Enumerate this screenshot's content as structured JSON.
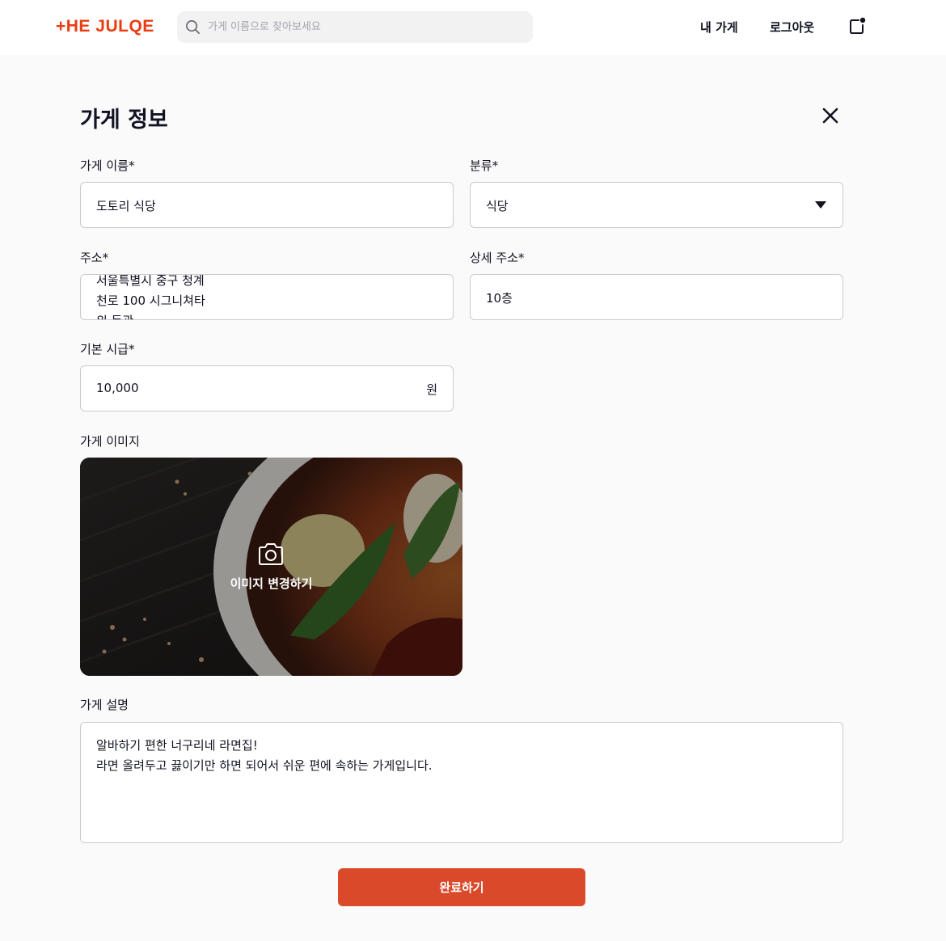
{
  "header": {
    "logo_text": "+HE JULQE",
    "search_placeholder": "가게 이름으로 찾아보세요",
    "nav_my_store": "내 가게",
    "nav_logout": "로그아웃",
    "icons": {
      "search": "search-icon",
      "notification": "bell-icon"
    },
    "accent_color": "#ea3c12"
  },
  "form": {
    "title": "가게 정보",
    "close_icon": "close-icon",
    "name_label": "가게 이름*",
    "name_value": "도토리 식당",
    "category_label": "분류*",
    "category_value": "식당",
    "address_label": "주소*",
    "address_value_lines": [
      "서울특별시 중구 청계",
      "천로 100 시그니쳐타",
      "워 동관"
    ],
    "address_detail_label": "상세 주소*",
    "address_detail_value": "10층",
    "wage_label": "기본 시급*",
    "wage_value": "10,000",
    "wage_unit": "원",
    "image_label": "가게 이미지",
    "image_change_label": "이미지 변경하기",
    "description_label": "가게 설명",
    "description_lines": [
      "알바하기 편한 너구리네 라면집!",
      "라면 올려두고 끓이기만 하면 되어서 쉬운 편에 속하는 가게입니다."
    ],
    "submit_label": "완료하기",
    "submit_color": "#d9492a"
  }
}
